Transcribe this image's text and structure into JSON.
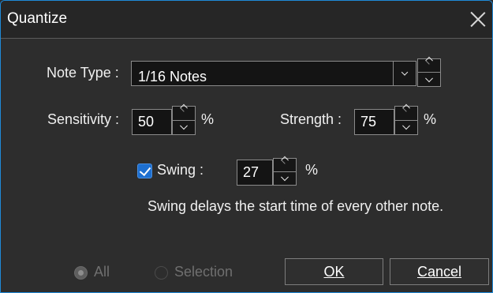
{
  "dialog": {
    "title": "Quantize",
    "note_type": {
      "label": "Note Type :",
      "value": "1/16 Notes"
    },
    "sensitivity": {
      "label": "Sensitivity :",
      "value": "50",
      "unit": "%"
    },
    "strength": {
      "label": "Strength :",
      "value": "75",
      "unit": "%"
    },
    "swing": {
      "label": "Swing :",
      "checked": true,
      "value": "27",
      "unit": "%"
    },
    "swing_description": "Swing delays the start time of every other note.",
    "range": {
      "all_label": "All",
      "selection_label": "Selection",
      "selected": "All"
    },
    "ok_label": "OK",
    "cancel_label": "Cancel"
  },
  "colors": {
    "accent": "#1d6fd0",
    "border": "#1f8ad8",
    "background": "#2d2d2d"
  }
}
